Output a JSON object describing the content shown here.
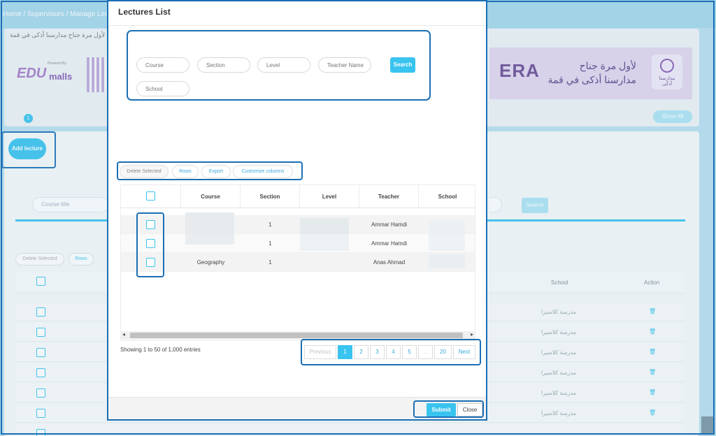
{
  "breadcrumb": "Home / Supervisors / Manage Lec",
  "background": {
    "arabic_strip": "لأول مرة جناح مدارسنا أذكى في قمة",
    "edu_logo": {
      "powered": "Powered By",
      "edu": "EDU",
      "malls": "malls"
    },
    "banner": {
      "era": "ERA",
      "line1": "لأول مرة جناح",
      "line2": "مدارسنا أذكى في قمة",
      "logo_text": "مدارسنا أذكى"
    },
    "badge": "1",
    "show_all": "Show All",
    "add_lecture": "Add lecture",
    "course_title_placeholder": "Course title",
    "search": "Search",
    "delete_selected": "Delete Selected",
    "rows": "Rows",
    "headers": {
      "school": "School",
      "action": "Action"
    },
    "school_value": "مدرسة كلاسيرا",
    "trash_icon": "trash-icon"
  },
  "modal": {
    "title": "Lectures List",
    "filters": {
      "course": "Course",
      "section": "Section",
      "level": "Level",
      "teacher": "Teacher Name",
      "school": "School",
      "search_label": "Search"
    },
    "toolbar": {
      "delete_selected": "Delete Selected",
      "rows": "Rows",
      "export": "Export",
      "customize": "Customize columns"
    },
    "columns": [
      "Course",
      "Section",
      "Level",
      "Teacher",
      "School"
    ],
    "rows": [
      {
        "course": "",
        "section": "1",
        "level": "",
        "teacher": "Ammar Hamdi",
        "school": ""
      },
      {
        "course": "",
        "section": "1",
        "level": "",
        "teacher": "Ammar Hamdi",
        "school": ""
      },
      {
        "course": "Geography",
        "section": "1",
        "level": "",
        "teacher": "Anas Ahmad",
        "school": ""
      }
    ],
    "showing": "Showing 1 to 50 of 1,000 entries",
    "pagination": {
      "previous": "Previous",
      "pages": [
        "1",
        "2",
        "3",
        "4",
        "5",
        "...",
        "20"
      ],
      "next": "Next",
      "active": "1"
    },
    "footer": {
      "submit": "Submit",
      "close": "Close"
    }
  },
  "colors": {
    "accent": "#39c4ef",
    "highlight": "#1a6fb5"
  }
}
